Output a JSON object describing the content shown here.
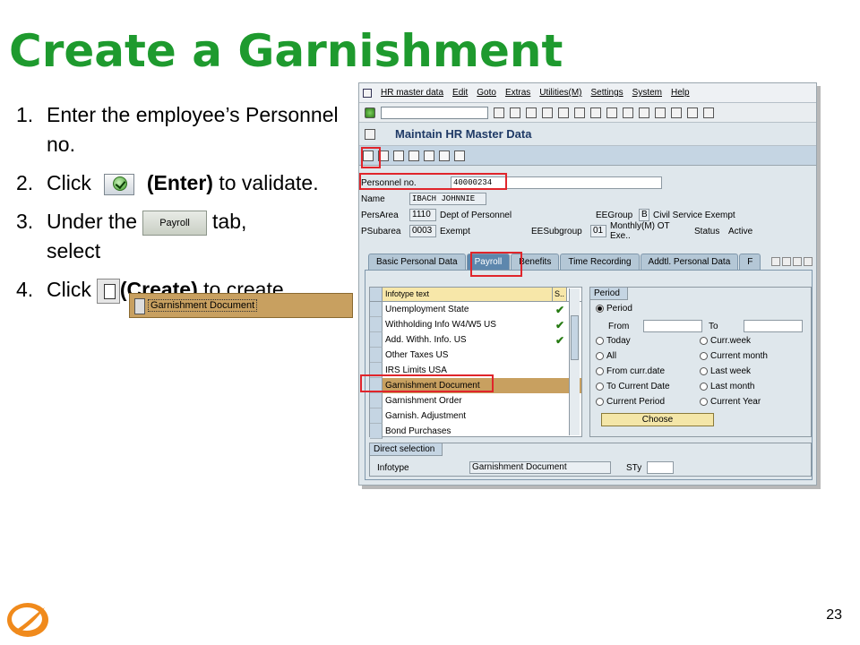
{
  "slide": {
    "title": "Create a Garnishment",
    "page_number": "23"
  },
  "steps": [
    {
      "num": "1.",
      "text": "Enter the employee’s Personnel no."
    },
    {
      "num": "2.",
      "pre": "Click",
      "bold": "(Enter)",
      "post": "to validate."
    },
    {
      "num": "3.",
      "pre": "Under the",
      "post": "tab,",
      "line2": "select",
      "tab_label": "Payroll",
      "selection_label": "Garnishment Document"
    },
    {
      "num": "4.",
      "pre": "Click",
      "bold": "(Create)",
      "post": "to create."
    }
  ],
  "sap": {
    "menu": [
      "HR master data",
      "Edit",
      "Goto",
      "Extras",
      "Utilities(M)",
      "Settings",
      "System",
      "Help"
    ],
    "screen_title": "Maintain HR Master Data",
    "header": {
      "personnel_no_label": "Personnel no.",
      "personnel_no_value": "40000234",
      "name_label": "Name",
      "name_value": "IBACH JOHNNIE",
      "persarea_label": "PersArea",
      "persarea_code": "1110",
      "persarea_text": "Dept of Personnel",
      "eegroup_label": "EEGroup",
      "eegroup_code": "B",
      "eegroup_text": "Civil Service Exempt",
      "psubarea_label": "PSubarea",
      "psubarea_code": "0003",
      "psubarea_text": "Exempt",
      "eesubgroup_label": "EESubgroup",
      "eesubgroup_code": "01",
      "eesubgroup_text": "Monthly(M) OT Exe..",
      "status_label": "Status",
      "status_value": "Active"
    },
    "tabs": [
      "Basic Personal Data",
      "Payroll",
      "Benefits",
      "Time Recording",
      "Addtl. Personal Data",
      "F"
    ],
    "active_tab": "Payroll",
    "infotype_list": {
      "col_header": "Infotype text",
      "col_s": "S..",
      "rows": [
        {
          "text": "Unemployment State",
          "check": "✔"
        },
        {
          "text": "Withholding Info W4/W5 US",
          "check": "✔"
        },
        {
          "text": "Add. Withh. Info.  US",
          "check": "✔"
        },
        {
          "text": "Other Taxes  US",
          "check": ""
        },
        {
          "text": "IRS Limits USA",
          "check": ""
        },
        {
          "text": "Garnishment Document",
          "check": "",
          "selected": true
        },
        {
          "text": "Garnishment Order",
          "check": ""
        },
        {
          "text": "Garnish. Adjustment",
          "check": ""
        },
        {
          "text": "Bond Purchases",
          "check": ""
        }
      ]
    },
    "period": {
      "group_title": "Period",
      "period_label": "Period",
      "from_label": "From",
      "to_label": "To",
      "options_left": [
        "Today",
        "All",
        "From curr.date",
        "To Current Date",
        "Current Period"
      ],
      "options_right": [
        "Curr.week",
        "Current month",
        "Last week",
        "Last month",
        "Current Year"
      ],
      "choose_label": "Choose"
    },
    "direct_selection": {
      "group_title": "Direct selection",
      "infotype_label": "Infotype",
      "infotype_value": "Garnishment Document",
      "sty_label": "STy",
      "sty_value": ""
    }
  },
  "colors": {
    "title_green": "#1e9a2e",
    "highlight_red": "#e0252b",
    "selected_row": "#c8a060"
  }
}
